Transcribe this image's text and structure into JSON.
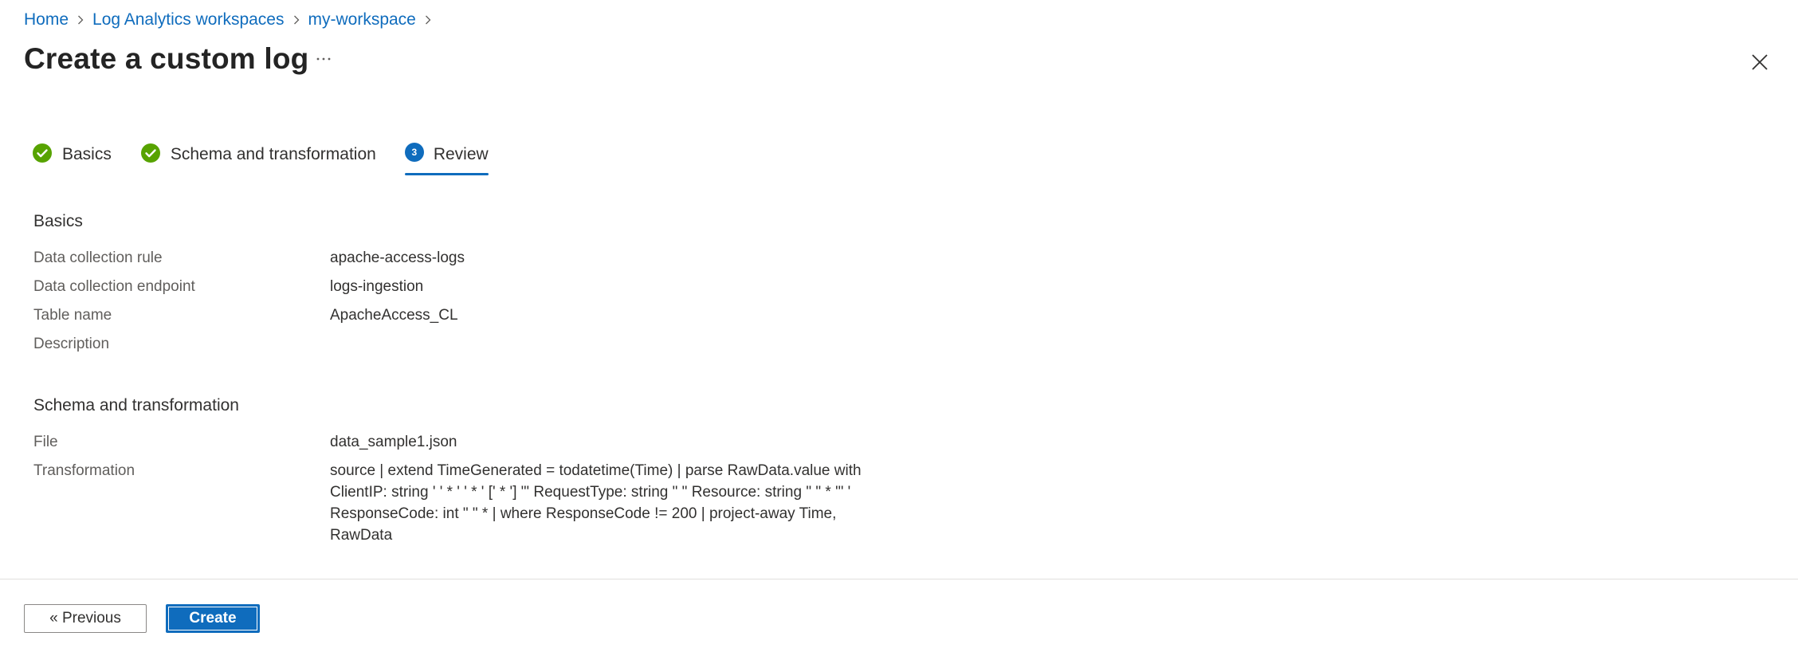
{
  "breadcrumb": {
    "items": [
      "Home",
      "Log Analytics workspaces",
      "my-workspace"
    ]
  },
  "header": {
    "title": "Create a custom log",
    "more_label": "···"
  },
  "tabs": [
    {
      "label": "Basics",
      "state": "complete"
    },
    {
      "label": "Schema and transformation",
      "state": "complete"
    },
    {
      "label": "Review",
      "state": "active",
      "step": "3"
    }
  ],
  "basics": {
    "title": "Basics",
    "rows": [
      {
        "label": "Data collection rule",
        "value": "apache-access-logs"
      },
      {
        "label": "Data collection endpoint",
        "value": "logs-ingestion"
      },
      {
        "label": "Table name",
        "value": "ApacheAccess_CL"
      },
      {
        "label": "Description",
        "value": ""
      }
    ]
  },
  "schema": {
    "title": "Schema and transformation",
    "rows": [
      {
        "label": "File",
        "value": "data_sample1.json"
      },
      {
        "label": "Transformation",
        "value": "source | extend TimeGenerated = todatetime(Time) | parse RawData.value with ClientIP: string ' ' * ' ' * ' [' * '] \"' RequestType: string \" \" Resource: string \" \" * '\" ' ResponseCode: int \" \" * | where ResponseCode != 200 | project-away Time, RawData"
      }
    ]
  },
  "footer": {
    "previous_label": "« Previous",
    "create_label": "Create"
  },
  "colors": {
    "accent": "#0f6cbd",
    "success": "#57a300",
    "link": "#0f6cbd"
  }
}
